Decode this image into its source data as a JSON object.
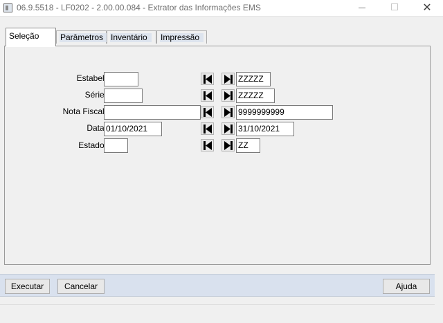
{
  "window": {
    "title": "06.9.5518 - LF0202 - 2.00.00.084 - Extrator das Informações EMS",
    "close_glyph": "✕"
  },
  "tabs": [
    {
      "label": "Seleção",
      "active": true
    },
    {
      "label": "Parâmetros",
      "active": false
    },
    {
      "label": "Inventário",
      "active": false
    },
    {
      "label": "Impressão",
      "active": false
    }
  ],
  "form": {
    "rows": [
      {
        "label": "Estabel:",
        "from": "",
        "to": "ZZZZZ"
      },
      {
        "label": "Série:",
        "from": "",
        "to": "ZZZZZ"
      },
      {
        "label": "Nota Fiscal:",
        "from": "",
        "to": "9999999999"
      },
      {
        "label": "Data:",
        "from": "01/10/2021",
        "to": "31/10/2021"
      },
      {
        "label": "Estado:",
        "from": "",
        "to": "ZZ"
      }
    ],
    "icons": {
      "first": "first-record-icon",
      "last": "last-record-icon"
    }
  },
  "buttons": {
    "executar": "Executar",
    "cancelar": "Cancelar",
    "ajuda": "Ajuda"
  },
  "colors": {
    "accent_bar": "#d9e1ee",
    "tab_highlight": "#dde4ee",
    "icon": "#000000"
  }
}
